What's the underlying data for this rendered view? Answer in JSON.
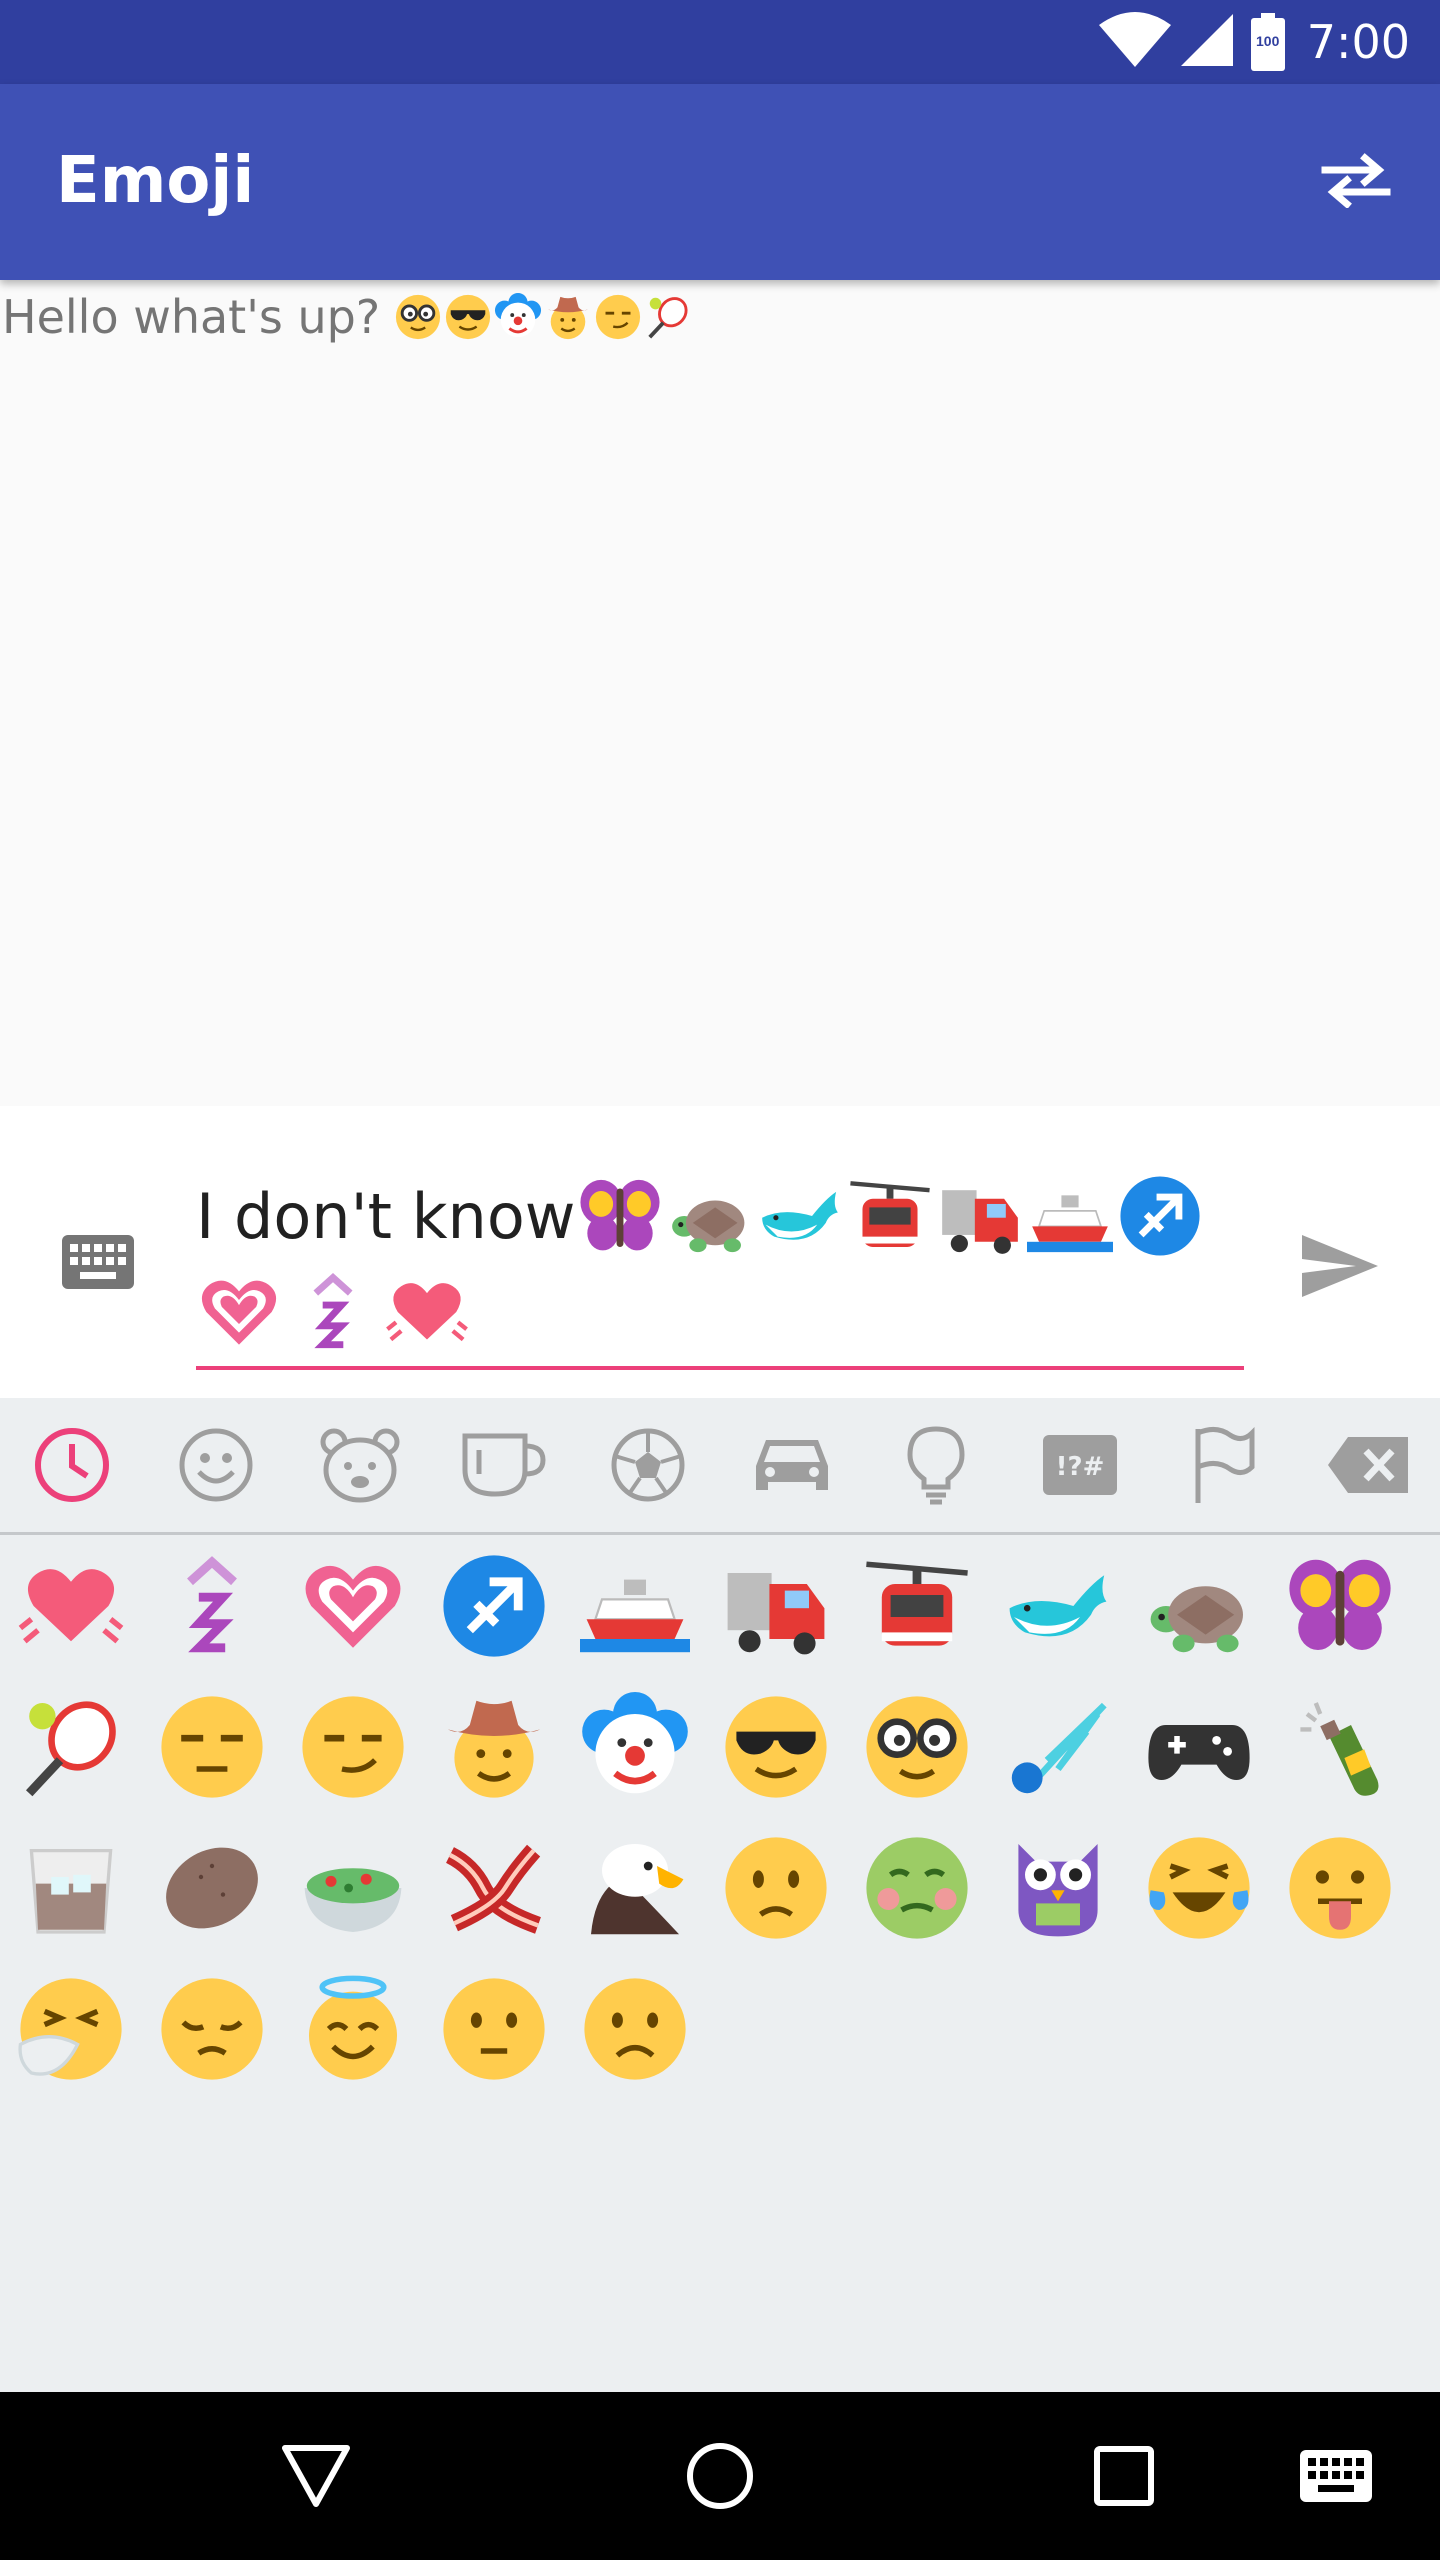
{
  "status_bar": {
    "time": "7:00",
    "battery_level": "100"
  },
  "app_bar": {
    "title": "Emoji",
    "swap_icon": "swap-arrows-icon"
  },
  "message": {
    "text": "Hello what's up?",
    "emojis": [
      "nerd-face",
      "sunglasses-face",
      "clown-face",
      "cowboy-face",
      "smirking-face",
      "tennis-racket"
    ]
  },
  "input": {
    "text": "I don't know",
    "emojis_line1": [
      "butterfly",
      "turtle",
      "whale",
      "aerial-tramway",
      "truck",
      "ship",
      "sagittarius"
    ],
    "emojis_line2": [
      "heart-outline",
      "zigzag-arrow",
      "beating-heart"
    ],
    "underline_color": "#ec407a"
  },
  "keyboard": {
    "categories": [
      "recent",
      "smileys",
      "animals",
      "food",
      "activity",
      "travel",
      "objects",
      "symbols",
      "flags"
    ],
    "selected_category": "recent",
    "accent_color": "#ec407a",
    "recent_emojis": [
      "beating-heart",
      "zigzag-arrow",
      "heart-outline",
      "sagittarius",
      "ship",
      "truck",
      "aerial-tramway",
      "whale",
      "turtle",
      "butterfly",
      "tennis-racket",
      "unamused-face",
      "smirking-face",
      "cowboy-face",
      "clown-face",
      "sunglasses-face",
      "nerd-face",
      "comet",
      "game-controller",
      "champagne",
      "whisky-glass",
      "potato",
      "salad",
      "bacon",
      "eagle",
      "worried-face",
      "nauseated-face",
      "owl",
      "crying-laughing-face",
      "tongue-face",
      "sneezing-face",
      "pensive-face",
      "halo-face",
      "neutral-face",
      "frowning-face"
    ]
  },
  "colors": {
    "primary": "#3f51b5",
    "primary_dark": "#303f9f"
  }
}
